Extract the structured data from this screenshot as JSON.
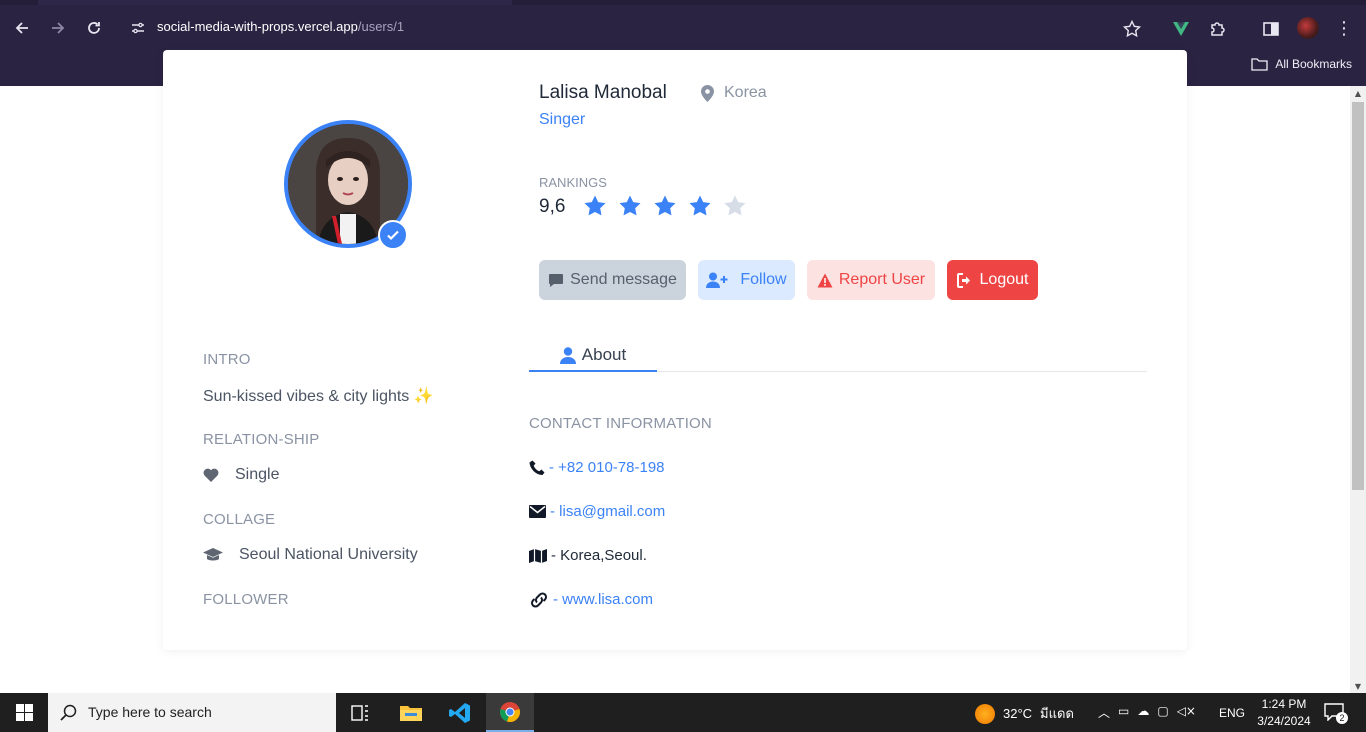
{
  "browser": {
    "url_host": "social-media-with-props.vercel.app",
    "url_path": "/users/1",
    "bookmarks_label": "All Bookmarks"
  },
  "profile": {
    "name": "Lalisa Manobal",
    "location": "Korea",
    "occupation": "Singer",
    "rankings_label": "RANKINGS",
    "rating": "9,6",
    "stars_filled": 4,
    "stars_total": 5,
    "verified": true
  },
  "actions": {
    "send_message": "Send message",
    "follow": "Follow",
    "report": "Report User",
    "logout": "Logout"
  },
  "tabs": {
    "about": "About"
  },
  "sidebar": {
    "intro_label": "INTRO",
    "intro_text": "Sun-kissed vibes & city lights ✨",
    "relationship_label": "RELATION-SHIP",
    "relationship_value": "Single",
    "college_label": "COLLAGE",
    "college_value": "Seoul National University",
    "follower_label": "FOLLOWER"
  },
  "contact": {
    "label": "CONTACT INFORMATION",
    "phone": "- +82 010-78-198",
    "email": "- lisa@gmail.com",
    "address": "- Korea,Seoul.",
    "website": "- www.lisa.com"
  },
  "taskbar": {
    "search_placeholder": "Type here to search",
    "weather": "32°C",
    "weather_desc": "มีแดด",
    "lang": "ENG",
    "time": "1:24 PM",
    "date": "3/24/2024",
    "notifications": "2"
  },
  "colors": {
    "accent": "#3b82f6",
    "danger": "#ef4444",
    "chrome_bg": "#2a2342"
  }
}
